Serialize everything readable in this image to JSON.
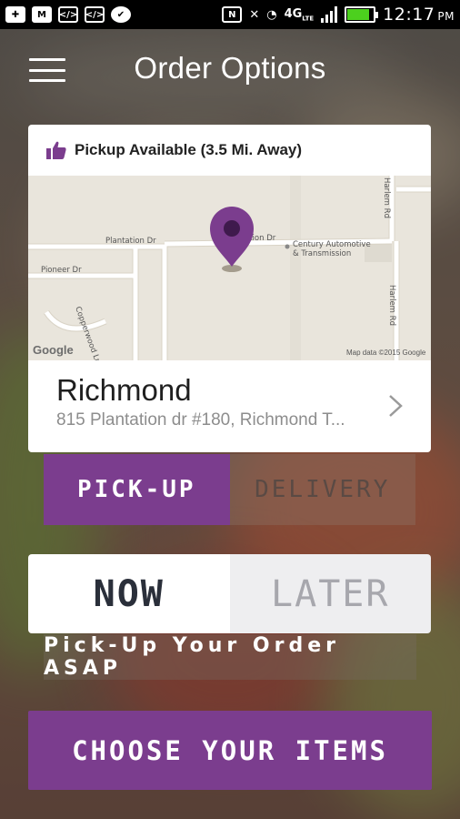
{
  "status_bar": {
    "network": "4G",
    "network_sub": "LTE",
    "time": "12:17",
    "meridiem": "PM",
    "battery_level": 0.85,
    "battery_color": "#4cd01e"
  },
  "header": {
    "title": "Order Options",
    "menu_icon": "hamburger-menu-icon"
  },
  "location_card": {
    "availability": "Pickup Available (3.5 Mi. Away)",
    "availability_icon": "thumbs-up-icon",
    "map": {
      "labels": {
        "plantation_dr": "Plantation Dr",
        "plantation_dr_2": "ation Dr",
        "pioneer_dr": "Pioneer Dr",
        "copperwood_ln": "Copperwood Ln",
        "harlem_rd_top": "Harlem Rd",
        "harlem_rd_side": "Harlem Rd",
        "business_line1": "Century Automotive",
        "business_line2": "& Transmission",
        "brand": "Google",
        "attribution": "Map data ©2015 Google"
      }
    },
    "store_name": "Richmond",
    "store_address": "815 Plantation dr #180, Richmond T..."
  },
  "fulfillment": {
    "options": [
      "PICK-UP",
      "DELIVERY"
    ],
    "selected": "PICK-UP"
  },
  "timing": {
    "options": [
      "NOW",
      "LATER"
    ],
    "selected": "NOW",
    "hint": "Pick-Up Your Order ASAP"
  },
  "cta": {
    "label": "CHOOSE YOUR ITEMS"
  },
  "colors": {
    "accent": "#7b3d8e"
  }
}
